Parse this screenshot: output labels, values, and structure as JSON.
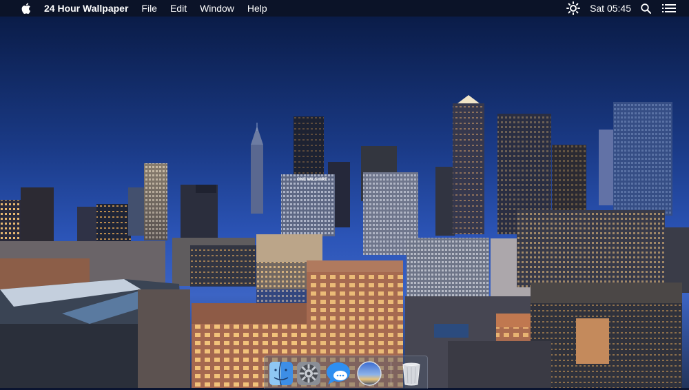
{
  "menubar": {
    "apple_icon": "apple-logo-icon",
    "app_name": "24 Hour Wallpaper",
    "menus": [
      "File",
      "Edit",
      "Window",
      "Help"
    ],
    "status": {
      "brightness_icon": "sun-icon",
      "clock": "Sat 05:45",
      "search_icon": "search-icon",
      "list_icon": "list-icon"
    }
  },
  "wallpaper": {
    "description_icon": "city-skyline-dusk",
    "building_sign": "ONE WILSHIRE"
  },
  "dock": {
    "items": [
      {
        "name": "finder",
        "icon": "finder-icon"
      },
      {
        "name": "system-preferences",
        "icon": "gear-icon"
      },
      {
        "name": "messages",
        "icon": "speech-bubble-icon"
      },
      {
        "name": "24-hour-wallpaper",
        "icon": "wallpaper-app-icon"
      },
      {
        "name": "trash",
        "icon": "trash-icon"
      }
    ]
  }
}
